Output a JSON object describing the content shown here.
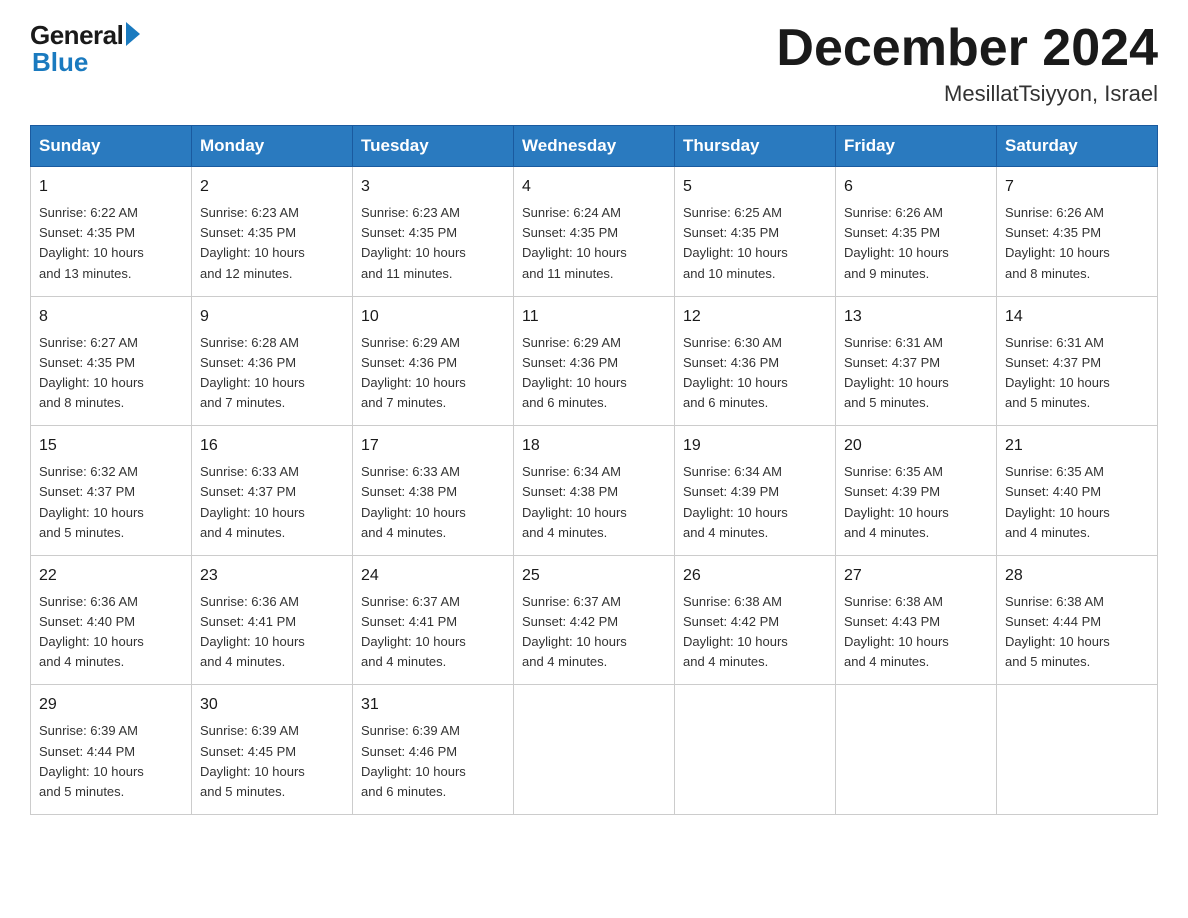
{
  "logo": {
    "general": "General",
    "blue": "Blue"
  },
  "title": "December 2024",
  "subtitle": "MesillatTsiyyon, Israel",
  "weekdays": [
    "Sunday",
    "Monday",
    "Tuesday",
    "Wednesday",
    "Thursday",
    "Friday",
    "Saturday"
  ],
  "weeks": [
    [
      {
        "day": "1",
        "sunrise": "6:22 AM",
        "sunset": "4:35 PM",
        "daylight": "10 hours and 13 minutes."
      },
      {
        "day": "2",
        "sunrise": "6:23 AM",
        "sunset": "4:35 PM",
        "daylight": "10 hours and 12 minutes."
      },
      {
        "day": "3",
        "sunrise": "6:23 AM",
        "sunset": "4:35 PM",
        "daylight": "10 hours and 11 minutes."
      },
      {
        "day": "4",
        "sunrise": "6:24 AM",
        "sunset": "4:35 PM",
        "daylight": "10 hours and 11 minutes."
      },
      {
        "day": "5",
        "sunrise": "6:25 AM",
        "sunset": "4:35 PM",
        "daylight": "10 hours and 10 minutes."
      },
      {
        "day": "6",
        "sunrise": "6:26 AM",
        "sunset": "4:35 PM",
        "daylight": "10 hours and 9 minutes."
      },
      {
        "day": "7",
        "sunrise": "6:26 AM",
        "sunset": "4:35 PM",
        "daylight": "10 hours and 8 minutes."
      }
    ],
    [
      {
        "day": "8",
        "sunrise": "6:27 AM",
        "sunset": "4:35 PM",
        "daylight": "10 hours and 8 minutes."
      },
      {
        "day": "9",
        "sunrise": "6:28 AM",
        "sunset": "4:36 PM",
        "daylight": "10 hours and 7 minutes."
      },
      {
        "day": "10",
        "sunrise": "6:29 AM",
        "sunset": "4:36 PM",
        "daylight": "10 hours and 7 minutes."
      },
      {
        "day": "11",
        "sunrise": "6:29 AM",
        "sunset": "4:36 PM",
        "daylight": "10 hours and 6 minutes."
      },
      {
        "day": "12",
        "sunrise": "6:30 AM",
        "sunset": "4:36 PM",
        "daylight": "10 hours and 6 minutes."
      },
      {
        "day": "13",
        "sunrise": "6:31 AM",
        "sunset": "4:37 PM",
        "daylight": "10 hours and 5 minutes."
      },
      {
        "day": "14",
        "sunrise": "6:31 AM",
        "sunset": "4:37 PM",
        "daylight": "10 hours and 5 minutes."
      }
    ],
    [
      {
        "day": "15",
        "sunrise": "6:32 AM",
        "sunset": "4:37 PM",
        "daylight": "10 hours and 5 minutes."
      },
      {
        "day": "16",
        "sunrise": "6:33 AM",
        "sunset": "4:37 PM",
        "daylight": "10 hours and 4 minutes."
      },
      {
        "day": "17",
        "sunrise": "6:33 AM",
        "sunset": "4:38 PM",
        "daylight": "10 hours and 4 minutes."
      },
      {
        "day": "18",
        "sunrise": "6:34 AM",
        "sunset": "4:38 PM",
        "daylight": "10 hours and 4 minutes."
      },
      {
        "day": "19",
        "sunrise": "6:34 AM",
        "sunset": "4:39 PM",
        "daylight": "10 hours and 4 minutes."
      },
      {
        "day": "20",
        "sunrise": "6:35 AM",
        "sunset": "4:39 PM",
        "daylight": "10 hours and 4 minutes."
      },
      {
        "day": "21",
        "sunrise": "6:35 AM",
        "sunset": "4:40 PM",
        "daylight": "10 hours and 4 minutes."
      }
    ],
    [
      {
        "day": "22",
        "sunrise": "6:36 AM",
        "sunset": "4:40 PM",
        "daylight": "10 hours and 4 minutes."
      },
      {
        "day": "23",
        "sunrise": "6:36 AM",
        "sunset": "4:41 PM",
        "daylight": "10 hours and 4 minutes."
      },
      {
        "day": "24",
        "sunrise": "6:37 AM",
        "sunset": "4:41 PM",
        "daylight": "10 hours and 4 minutes."
      },
      {
        "day": "25",
        "sunrise": "6:37 AM",
        "sunset": "4:42 PM",
        "daylight": "10 hours and 4 minutes."
      },
      {
        "day": "26",
        "sunrise": "6:38 AM",
        "sunset": "4:42 PM",
        "daylight": "10 hours and 4 minutes."
      },
      {
        "day": "27",
        "sunrise": "6:38 AM",
        "sunset": "4:43 PM",
        "daylight": "10 hours and 4 minutes."
      },
      {
        "day": "28",
        "sunrise": "6:38 AM",
        "sunset": "4:44 PM",
        "daylight": "10 hours and 5 minutes."
      }
    ],
    [
      {
        "day": "29",
        "sunrise": "6:39 AM",
        "sunset": "4:44 PM",
        "daylight": "10 hours and 5 minutes."
      },
      {
        "day": "30",
        "sunrise": "6:39 AM",
        "sunset": "4:45 PM",
        "daylight": "10 hours and 5 minutes."
      },
      {
        "day": "31",
        "sunrise": "6:39 AM",
        "sunset": "4:46 PM",
        "daylight": "10 hours and 6 minutes."
      },
      null,
      null,
      null,
      null
    ]
  ]
}
